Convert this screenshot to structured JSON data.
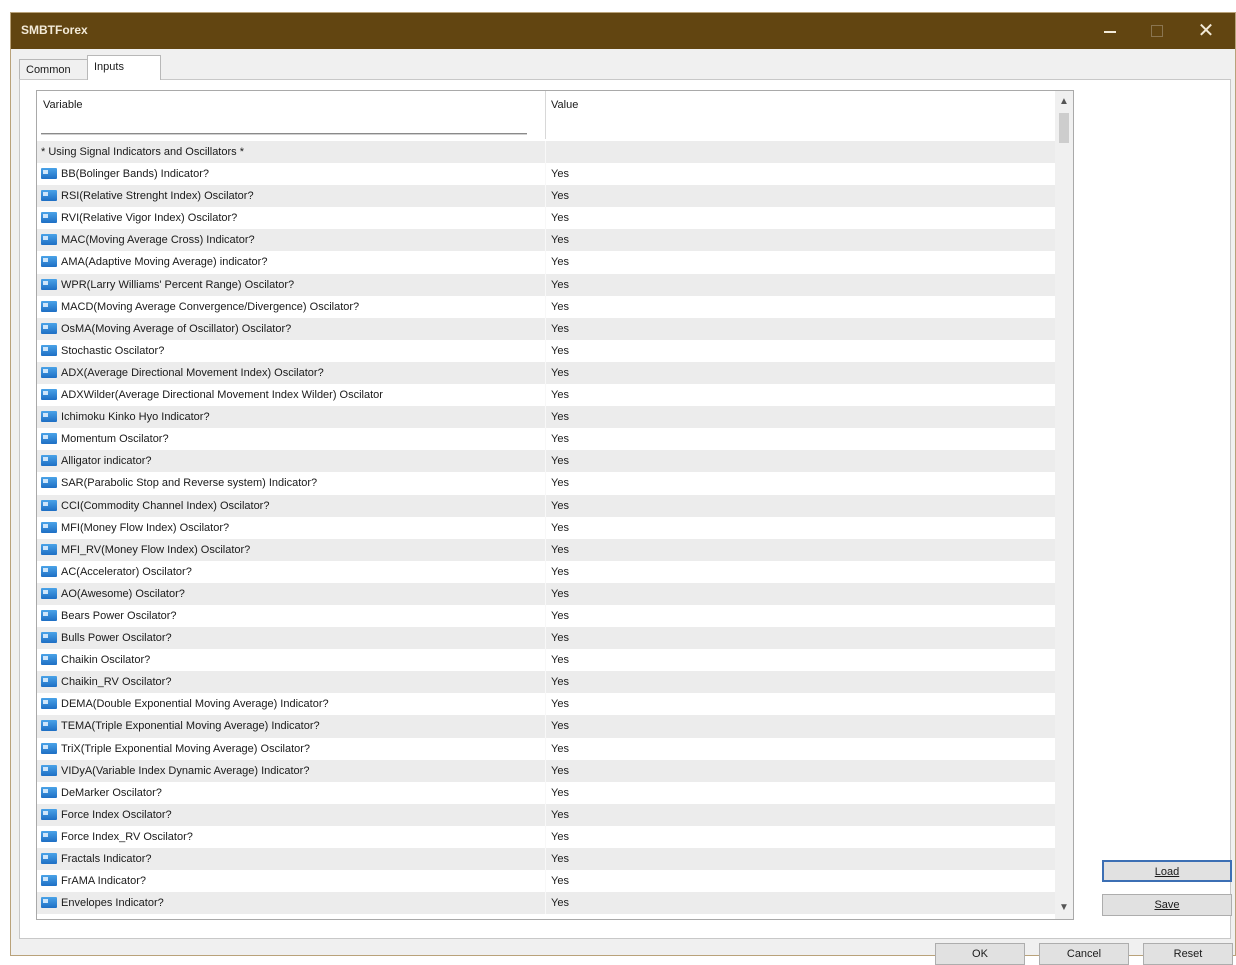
{
  "window": {
    "title": "SMBTForex",
    "controls": {
      "minimize_icon": "minimize-icon",
      "maximize_icon": "maximize-icon",
      "close_label": "✕"
    }
  },
  "tabs": [
    {
      "label": "Common",
      "selected": false
    },
    {
      "label": "Inputs",
      "selected": true
    }
  ],
  "grid": {
    "columns": {
      "variable": "Variable",
      "value": "Value"
    },
    "heading_row": "* Using Signal Indicators and Oscillators *",
    "rows": [
      {
        "variable": "BB(Bolinger Bands) Indicator?",
        "value": "Yes"
      },
      {
        "variable": "RSI(Relative Strenght Index) Oscilator?",
        "value": "Yes"
      },
      {
        "variable": "RVI(Relative Vigor Index) Oscilator?",
        "value": "Yes"
      },
      {
        "variable": "MAC(Moving Average Cross) Indicator?",
        "value": "Yes"
      },
      {
        "variable": "AMA(Adaptive Moving Average) indicator?",
        "value": "Yes"
      },
      {
        "variable": "WPR(Larry Williams' Percent Range) Oscilator?",
        "value": "Yes"
      },
      {
        "variable": "MACD(Moving Average Convergence/Divergence) Oscilator?",
        "value": "Yes"
      },
      {
        "variable": "OsMA(Moving Average of Oscillator) Oscilator?",
        "value": "Yes"
      },
      {
        "variable": "Stochastic Oscilator?",
        "value": "Yes"
      },
      {
        "variable": "ADX(Average Directional Movement Index) Oscilator?",
        "value": "Yes"
      },
      {
        "variable": "ADXWilder(Average Directional Movement Index Wilder) Oscilator",
        "value": "Yes"
      },
      {
        "variable": "Ichimoku Kinko Hyo Indicator?",
        "value": "Yes"
      },
      {
        "variable": "Momentum Oscilator?",
        "value": "Yes"
      },
      {
        "variable": "Alligator indicator?",
        "value": "Yes"
      },
      {
        "variable": "SAR(Parabolic Stop and Reverse system) Indicator?",
        "value": "Yes"
      },
      {
        "variable": "CCI(Commodity Channel Index) Oscilator?",
        "value": "Yes"
      },
      {
        "variable": "MFI(Money Flow Index) Oscilator?",
        "value": "Yes"
      },
      {
        "variable": "MFI_RV(Money Flow Index) Oscilator?",
        "value": "Yes"
      },
      {
        "variable": "AC(Accelerator) Oscilator?",
        "value": "Yes"
      },
      {
        "variable": "AO(Awesome) Oscilator?",
        "value": "Yes"
      },
      {
        "variable": "Bears Power Oscilator?",
        "value": "Yes"
      },
      {
        "variable": "Bulls Power Oscilator?",
        "value": "Yes"
      },
      {
        "variable": "Chaikin Oscilator?",
        "value": "Yes"
      },
      {
        "variable": "Chaikin_RV Oscilator?",
        "value": "Yes"
      },
      {
        "variable": "DEMA(Double Exponential Moving Average) Indicator?",
        "value": "Yes"
      },
      {
        "variable": "TEMA(Triple Exponential Moving Average) Indicator?",
        "value": "Yes"
      },
      {
        "variable": "TriX(Triple Exponential Moving Average) Oscilator?",
        "value": "Yes"
      },
      {
        "variable": "VIDyA(Variable Index Dynamic Average) Indicator?",
        "value": "Yes"
      },
      {
        "variable": "DeMarker Oscilator?",
        "value": "Yes"
      },
      {
        "variable": "Force Index Oscilator?",
        "value": "Yes"
      },
      {
        "variable": "Force Index_RV Oscilator?",
        "value": "Yes"
      },
      {
        "variable": "Fractals Indicator?",
        "value": "Yes"
      },
      {
        "variable": "FrAMA Indicator?",
        "value": "Yes"
      },
      {
        "variable": "Envelopes Indicator?",
        "value": "Yes"
      }
    ]
  },
  "buttons": {
    "load": "Load",
    "save": "Save",
    "ok": "OK",
    "cancel": "Cancel",
    "reset": "Reset"
  },
  "colors": {
    "titlebar": "#624511",
    "row_alt": "#ececec",
    "load_focus": "#3c6fb4"
  }
}
